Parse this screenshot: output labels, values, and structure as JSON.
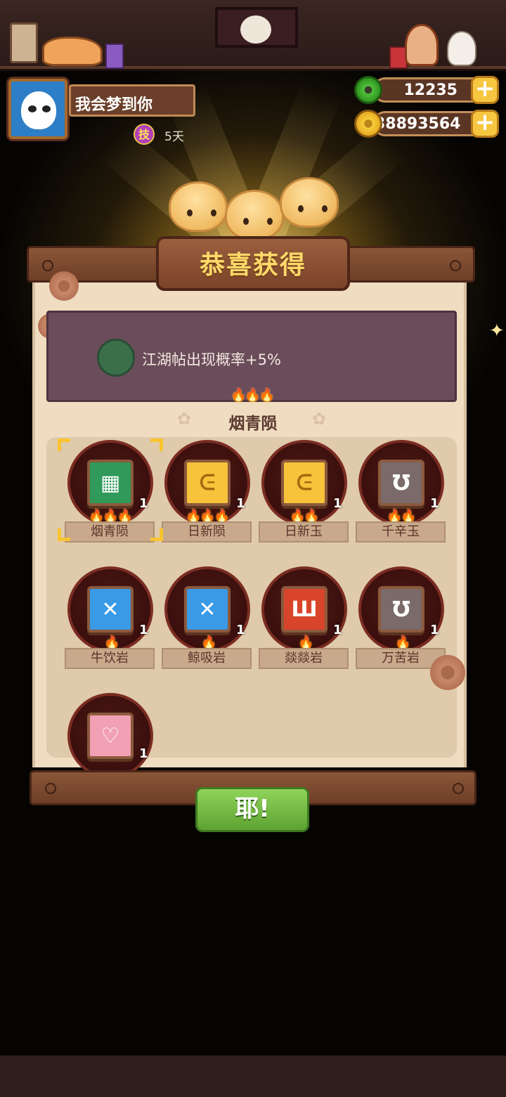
{
  "player": {
    "name": "我会梦到你",
    "skill_badge": "技",
    "days": "5天"
  },
  "currency": {
    "jade": "12235",
    "coins": "38893564"
  },
  "reward_panel": {
    "title": "恭喜获得",
    "bonus_text": "江湖帖出现概率+5%",
    "grade_flames": "🔥🔥🔥",
    "grade_name": "烟青陨",
    "confirm_label": "耶!"
  },
  "items": [
    {
      "name": "烟青陨",
      "qty": "1",
      "flames": "🔥🔥🔥",
      "color": "#2f9a5a",
      "glyph": "▦"
    },
    {
      "name": "日新陨",
      "qty": "1",
      "flames": "🔥🔥🔥",
      "color": "#f6c33a",
      "glyph": "ᕮ"
    },
    {
      "name": "日新玉",
      "qty": "1",
      "flames": "🔥🔥",
      "color": "#f6c33a",
      "glyph": "ᕮ"
    },
    {
      "name": "千辛玉",
      "qty": "1",
      "flames": "🔥🔥",
      "color": "#7a6a6a",
      "glyph": "Ʊ"
    },
    {
      "name": "牛饮岩",
      "qty": "1",
      "flames": "🔥",
      "color": "#3a9ae6",
      "glyph": "✕"
    },
    {
      "name": "鲸吸岩",
      "qty": "1",
      "flames": "🔥",
      "color": "#3a9ae6",
      "glyph": "✕"
    },
    {
      "name": "燚燚岩",
      "qty": "1",
      "flames": "🔥",
      "color": "#d8452a",
      "glyph": "Ш"
    },
    {
      "name": "万苦岩",
      "qty": "1",
      "flames": "🔥",
      "color": "#7a6a6a",
      "glyph": "Ʊ"
    },
    {
      "name": "",
      "qty": "1",
      "flames": "",
      "color": "#f2a0b4",
      "glyph": "♡"
    }
  ]
}
